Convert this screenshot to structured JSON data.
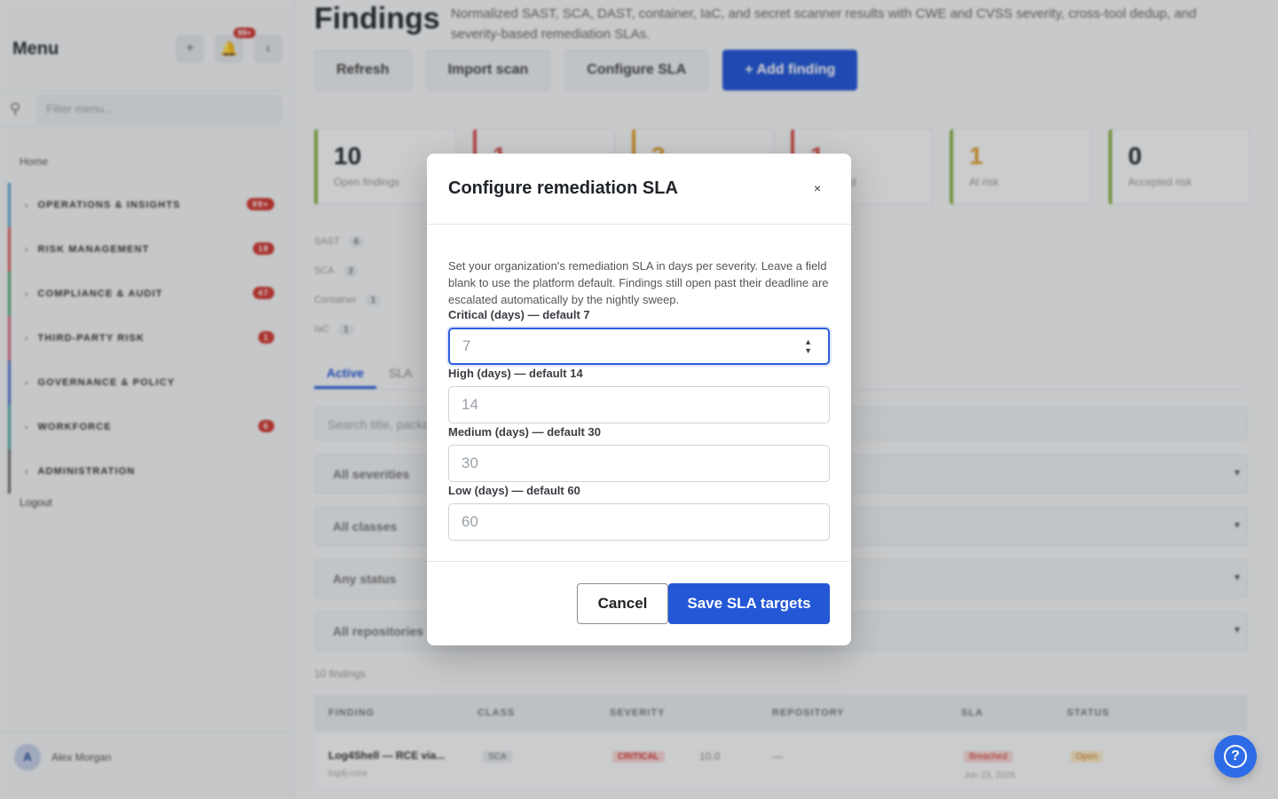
{
  "sidebar": {
    "title": "Menu",
    "add_icon": "plus-icon",
    "bell_badge": "99+",
    "search_placeholder": "Filter menu...",
    "home": "Home",
    "items": [
      {
        "label": "OPERATIONS & INSIGHTS",
        "count": "99+",
        "color": "#5aa0c8"
      },
      {
        "label": "RISK MANAGEMENT",
        "count": "18",
        "color": "#d9534f"
      },
      {
        "label": "COMPLIANCE & AUDIT",
        "count": "47",
        "color": "#4ca06e"
      },
      {
        "label": "THIRD-PARTY RISK",
        "count": "1",
        "color": "#d2627c"
      },
      {
        "label": "GOVERNANCE & POLICY",
        "count": "",
        "color": "#4a6cc8"
      },
      {
        "label": "WORKFORCE",
        "count": "6",
        "color": "#4aa0a0"
      },
      {
        "label": "ADMINISTRATION",
        "count": "",
        "color": "#666666"
      }
    ],
    "logout": "Logout",
    "user": {
      "initial": "A",
      "name": "Alex Morgan"
    }
  },
  "page": {
    "title": "Findings",
    "description": "Normalized SAST, SCA, DAST, container, IaC, and secret scanner results with CWE and CVSS severity, cross-tool dedup, and severity-based remediation SLAs.",
    "toolbar": {
      "refresh": "Refresh",
      "import": "Import scan",
      "configure": "Configure SLA",
      "add": "+ Add finding"
    },
    "stats": [
      {
        "num": "10",
        "label": "Open findings",
        "color": "#8bb04a"
      },
      {
        "num": "1",
        "label": "",
        "color": "#d9534f"
      },
      {
        "num": "3",
        "label": "",
        "color": "#e0a030"
      },
      {
        "num": "1",
        "label": "Breached",
        "color": "#d9534f"
      },
      {
        "num": "1",
        "label": "At risk",
        "color": "#8bb04a"
      },
      {
        "num": "0",
        "label": "Accepted risk",
        "color": "#8bb04a"
      }
    ],
    "chips": [
      {
        "label": "SAST",
        "count": "6"
      },
      {
        "label": "SCA",
        "count": "2"
      },
      {
        "label": "Container",
        "count": "1"
      },
      {
        "label": "IaC",
        "count": "1"
      }
    ],
    "tabs": {
      "active": "Active",
      "sla": "SLA"
    },
    "search_placeholder": "Search title, package...",
    "filters": [
      "All severities",
      "All classes",
      "Any status",
      "All repositories"
    ],
    "count_text": "10 findings",
    "columns": [
      "FINDING",
      "CLASS",
      "SEVERITY",
      "REPOSITORY",
      "SLA",
      "STATUS"
    ],
    "row": {
      "title": "Log4Shell — RCE via...",
      "sub": "log4j-core",
      "class": "SCA",
      "severity": "CRITICAL",
      "score": "10.0",
      "repo": "—",
      "sla": "Breached",
      "sla_date": "Jun 23, 2026",
      "status": "Open"
    }
  },
  "modal": {
    "title": "Configure remediation SLA",
    "close_label": "×",
    "description": "Set your organization's remediation SLA in days per severity. Leave a field blank to use the platform default. Findings still open past their deadline are escalated automatically by the nightly sweep.",
    "fields": [
      {
        "label": "Critical (days) — default 7",
        "placeholder": "7"
      },
      {
        "label": "High (days) — default 14",
        "placeholder": "14"
      },
      {
        "label": "Medium (days) — default 30",
        "placeholder": "30"
      },
      {
        "label": "Low (days) — default 60",
        "placeholder": "60"
      }
    ],
    "cancel": "Cancel",
    "save": "Save SLA targets"
  },
  "help_label": "?"
}
